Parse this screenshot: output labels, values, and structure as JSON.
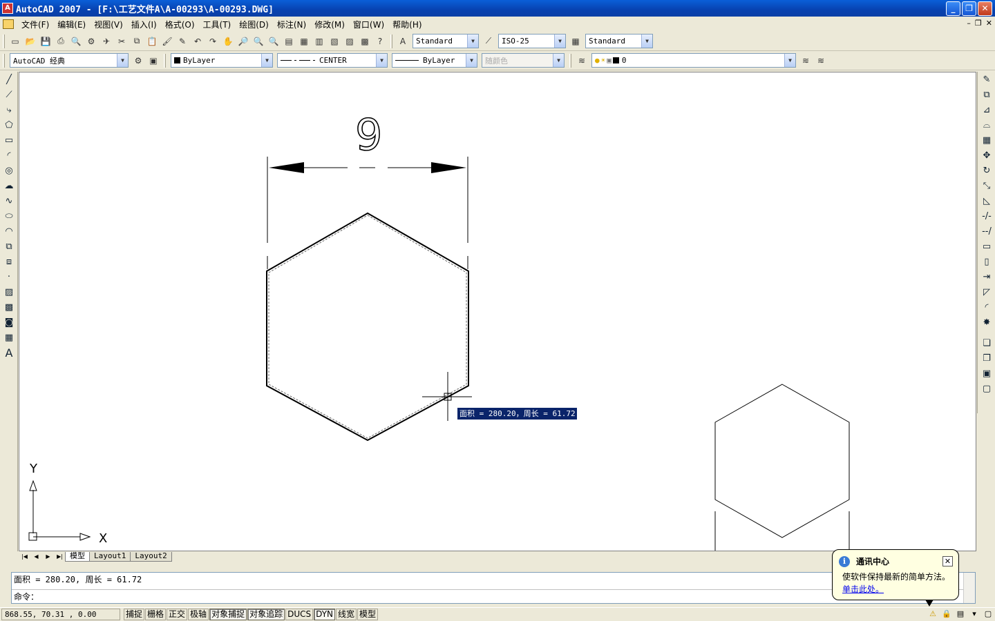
{
  "window": {
    "title": "AutoCAD 2007 - [F:\\工艺文件A\\A-00293\\A-00293.DWG]",
    "app_icon": "A",
    "minimize_glyph": "_",
    "restore_glyph": "❐",
    "close_glyph": "✕"
  },
  "menubar": {
    "items": [
      "文件(F)",
      "编辑(E)",
      "视图(V)",
      "插入(I)",
      "格式(O)",
      "工具(T)",
      "绘图(D)",
      "标注(N)",
      "修改(M)",
      "窗口(W)",
      "帮助(H)"
    ],
    "mdi": [
      "–",
      "❐",
      "✕"
    ]
  },
  "toolbar1": {
    "text_style": "Standard",
    "dim_style": "ISO-25",
    "table_style": "Standard"
  },
  "toolbar2": {
    "workspace": "AutoCAD 经典",
    "color": "ByLayer",
    "linetype": "CENTER",
    "lineweight": "ByLayer",
    "plotstyle": "随颜色",
    "layer": "0"
  },
  "canvas": {
    "dimension_text": "9",
    "tooltip": "面积 = 280.20，周长 = 61.72",
    "ucs_x": "X",
    "ucs_y": "Y"
  },
  "tabs": {
    "items": [
      "模型",
      "Layout1",
      "Layout2"
    ],
    "active": "模型"
  },
  "command": {
    "history": "面积 = 280.20,  周长 = 61.72",
    "prompt": "命令："
  },
  "status": {
    "coords": "868.55, 70.31 , 0.00",
    "buttons": [
      {
        "label": "捕捉",
        "on": false
      },
      {
        "label": "栅格",
        "on": false
      },
      {
        "label": "正交",
        "on": false
      },
      {
        "label": "极轴",
        "on": false
      },
      {
        "label": "对象捕捉",
        "on": true
      },
      {
        "label": "对象追踪",
        "on": true
      },
      {
        "label": "DUCS",
        "on": false
      },
      {
        "label": "DYN",
        "on": true
      },
      {
        "label": "线宽",
        "on": false
      },
      {
        "label": "模型",
        "on": false
      }
    ]
  },
  "balloon": {
    "title": "通讯中心",
    "text": "使软件保持最新的简单方法。",
    "link": "单击此处。"
  },
  "colors": {
    "title_blue": "#0842b0",
    "tooltip_bg": "#0a246a",
    "balloon_bg": "#ffffe1"
  }
}
